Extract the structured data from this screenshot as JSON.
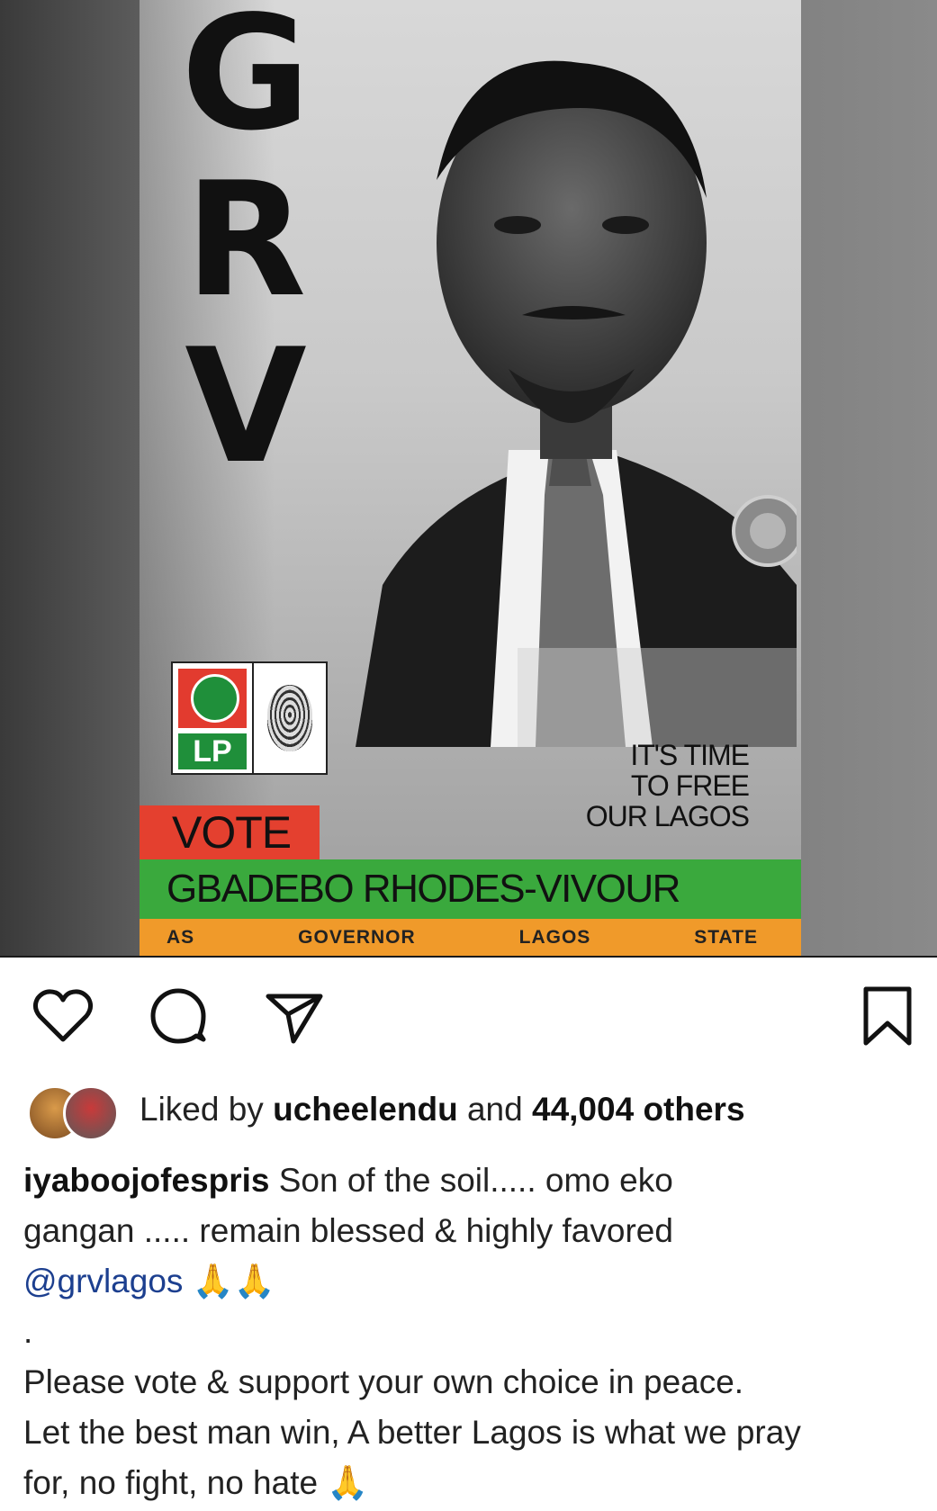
{
  "poster": {
    "initials": [
      "G",
      "R",
      "V"
    ],
    "party_logo_text": "LP",
    "slogan_lines": [
      "IT'S TIME",
      "TO FREE",
      "OUR LAGOS"
    ],
    "vote_label": "VOTE",
    "candidate_name": "GBADEBO RHODES-VIVOUR",
    "office_words": [
      "AS",
      "GOVERNOR",
      "LAGOS",
      "STATE"
    ],
    "colors": {
      "vote_band": "#e4402f",
      "name_band": "#3aa93d",
      "office_band": "#f09a2a"
    }
  },
  "actions": {
    "like_icon": "heart-icon",
    "comment_icon": "comment-icon",
    "share_icon": "send-icon",
    "save_icon": "bookmark-icon"
  },
  "likes": {
    "prefix": "Liked by",
    "user": "ucheelendu",
    "middle": "and",
    "others": "44,004 others"
  },
  "caption": {
    "username": "iyaboojofespris",
    "text_line1": " Son of the soil..... omo eko",
    "text_line2": "gangan ..... remain blessed & highly favored",
    "mention": "@grvlagos",
    "emoji_after_mention": "🙏🙏",
    "dot": ".",
    "para2_line1": "Please vote & support your own choice in peace.",
    "para2_line2": "Let the best man win, A better Lagos is what we pray",
    "para2_line3": "for, no fight, no hate",
    "emoji_end": "🙏"
  }
}
